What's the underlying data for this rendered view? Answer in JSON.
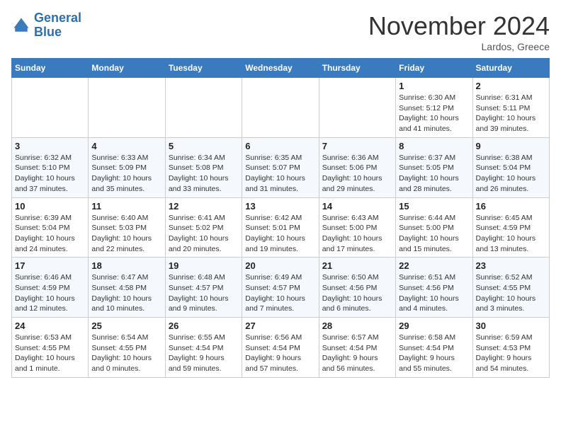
{
  "logo": {
    "line1": "General",
    "line2": "Blue"
  },
  "title": "November 2024",
  "location": "Lardos, Greece",
  "weekdays": [
    "Sunday",
    "Monday",
    "Tuesday",
    "Wednesday",
    "Thursday",
    "Friday",
    "Saturday"
  ],
  "weeks": [
    [
      {
        "day": "",
        "info": ""
      },
      {
        "day": "",
        "info": ""
      },
      {
        "day": "",
        "info": ""
      },
      {
        "day": "",
        "info": ""
      },
      {
        "day": "",
        "info": ""
      },
      {
        "day": "1",
        "info": "Sunrise: 6:30 AM\nSunset: 5:12 PM\nDaylight: 10 hours\nand 41 minutes."
      },
      {
        "day": "2",
        "info": "Sunrise: 6:31 AM\nSunset: 5:11 PM\nDaylight: 10 hours\nand 39 minutes."
      }
    ],
    [
      {
        "day": "3",
        "info": "Sunrise: 6:32 AM\nSunset: 5:10 PM\nDaylight: 10 hours\nand 37 minutes."
      },
      {
        "day": "4",
        "info": "Sunrise: 6:33 AM\nSunset: 5:09 PM\nDaylight: 10 hours\nand 35 minutes."
      },
      {
        "day": "5",
        "info": "Sunrise: 6:34 AM\nSunset: 5:08 PM\nDaylight: 10 hours\nand 33 minutes."
      },
      {
        "day": "6",
        "info": "Sunrise: 6:35 AM\nSunset: 5:07 PM\nDaylight: 10 hours\nand 31 minutes."
      },
      {
        "day": "7",
        "info": "Sunrise: 6:36 AM\nSunset: 5:06 PM\nDaylight: 10 hours\nand 29 minutes."
      },
      {
        "day": "8",
        "info": "Sunrise: 6:37 AM\nSunset: 5:05 PM\nDaylight: 10 hours\nand 28 minutes."
      },
      {
        "day": "9",
        "info": "Sunrise: 6:38 AM\nSunset: 5:04 PM\nDaylight: 10 hours\nand 26 minutes."
      }
    ],
    [
      {
        "day": "10",
        "info": "Sunrise: 6:39 AM\nSunset: 5:04 PM\nDaylight: 10 hours\nand 24 minutes."
      },
      {
        "day": "11",
        "info": "Sunrise: 6:40 AM\nSunset: 5:03 PM\nDaylight: 10 hours\nand 22 minutes."
      },
      {
        "day": "12",
        "info": "Sunrise: 6:41 AM\nSunset: 5:02 PM\nDaylight: 10 hours\nand 20 minutes."
      },
      {
        "day": "13",
        "info": "Sunrise: 6:42 AM\nSunset: 5:01 PM\nDaylight: 10 hours\nand 19 minutes."
      },
      {
        "day": "14",
        "info": "Sunrise: 6:43 AM\nSunset: 5:00 PM\nDaylight: 10 hours\nand 17 minutes."
      },
      {
        "day": "15",
        "info": "Sunrise: 6:44 AM\nSunset: 5:00 PM\nDaylight: 10 hours\nand 15 minutes."
      },
      {
        "day": "16",
        "info": "Sunrise: 6:45 AM\nSunset: 4:59 PM\nDaylight: 10 hours\nand 13 minutes."
      }
    ],
    [
      {
        "day": "17",
        "info": "Sunrise: 6:46 AM\nSunset: 4:59 PM\nDaylight: 10 hours\nand 12 minutes."
      },
      {
        "day": "18",
        "info": "Sunrise: 6:47 AM\nSunset: 4:58 PM\nDaylight: 10 hours\nand 10 minutes."
      },
      {
        "day": "19",
        "info": "Sunrise: 6:48 AM\nSunset: 4:57 PM\nDaylight: 10 hours\nand 9 minutes."
      },
      {
        "day": "20",
        "info": "Sunrise: 6:49 AM\nSunset: 4:57 PM\nDaylight: 10 hours\nand 7 minutes."
      },
      {
        "day": "21",
        "info": "Sunrise: 6:50 AM\nSunset: 4:56 PM\nDaylight: 10 hours\nand 6 minutes."
      },
      {
        "day": "22",
        "info": "Sunrise: 6:51 AM\nSunset: 4:56 PM\nDaylight: 10 hours\nand 4 minutes."
      },
      {
        "day": "23",
        "info": "Sunrise: 6:52 AM\nSunset: 4:55 PM\nDaylight: 10 hours\nand 3 minutes."
      }
    ],
    [
      {
        "day": "24",
        "info": "Sunrise: 6:53 AM\nSunset: 4:55 PM\nDaylight: 10 hours\nand 1 minute."
      },
      {
        "day": "25",
        "info": "Sunrise: 6:54 AM\nSunset: 4:55 PM\nDaylight: 10 hours\nand 0 minutes."
      },
      {
        "day": "26",
        "info": "Sunrise: 6:55 AM\nSunset: 4:54 PM\nDaylight: 9 hours\nand 59 minutes."
      },
      {
        "day": "27",
        "info": "Sunrise: 6:56 AM\nSunset: 4:54 PM\nDaylight: 9 hours\nand 57 minutes."
      },
      {
        "day": "28",
        "info": "Sunrise: 6:57 AM\nSunset: 4:54 PM\nDaylight: 9 hours\nand 56 minutes."
      },
      {
        "day": "29",
        "info": "Sunrise: 6:58 AM\nSunset: 4:54 PM\nDaylight: 9 hours\nand 55 minutes."
      },
      {
        "day": "30",
        "info": "Sunrise: 6:59 AM\nSunset: 4:53 PM\nDaylight: 9 hours\nand 54 minutes."
      }
    ]
  ]
}
